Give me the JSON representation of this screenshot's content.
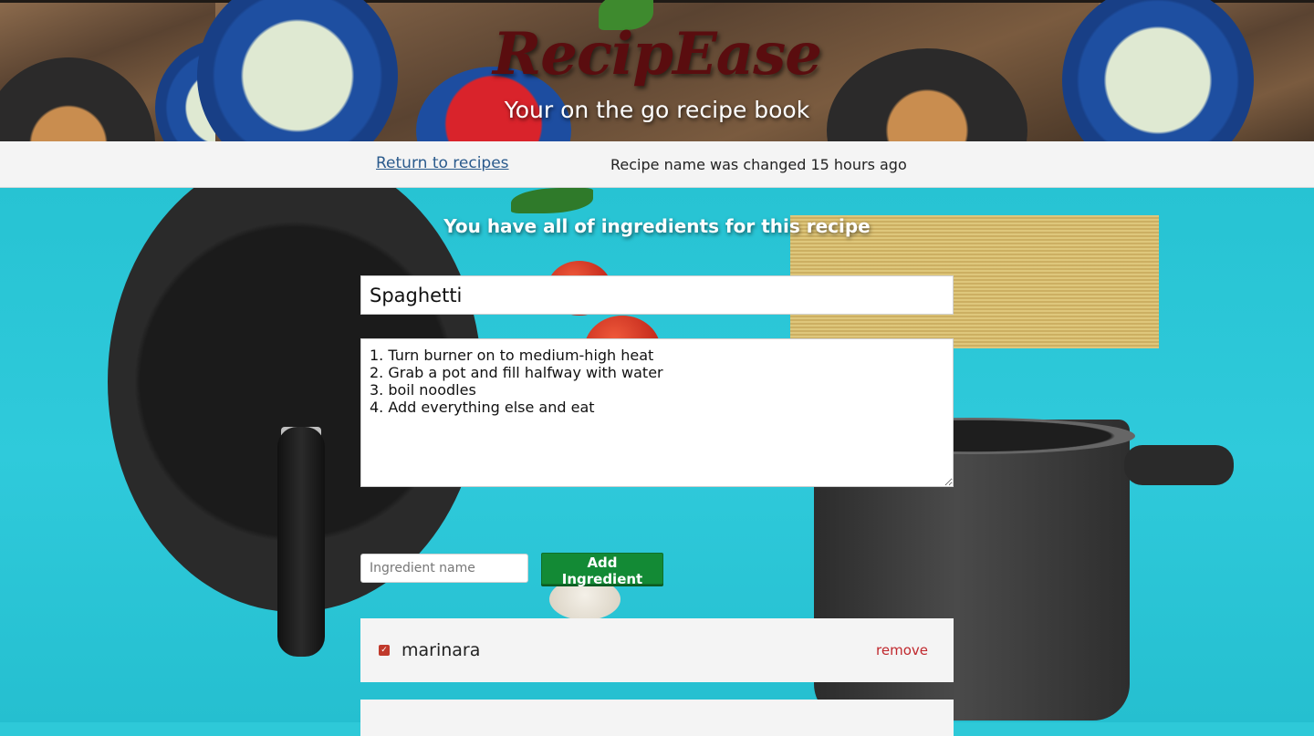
{
  "header": {
    "brand": "RecipEase",
    "tagline": "Your on the go recipe book"
  },
  "nav": {
    "back_link": "Return to recipes",
    "change_notice": "Recipe name was changed 15 hours ago"
  },
  "recipe": {
    "status": "You have all of ingredients for this recipe",
    "name": "Spaghetti",
    "instructions": "1. Turn burner on to medium-high heat\n2. Grab a pot and fill halfway with water\n3. boil noodles\n4. Add everything else and eat"
  },
  "ingredient_form": {
    "placeholder": "Ingredient name",
    "add_button": "Add Ingredient"
  },
  "ingredients": [
    {
      "name": "marinara",
      "checked": true,
      "remove_label": "remove"
    }
  ],
  "colors": {
    "brand": "#5a0d0f",
    "accent_button": "#138a35",
    "remove_link": "#c0282d",
    "background": "#2ec9d8"
  }
}
